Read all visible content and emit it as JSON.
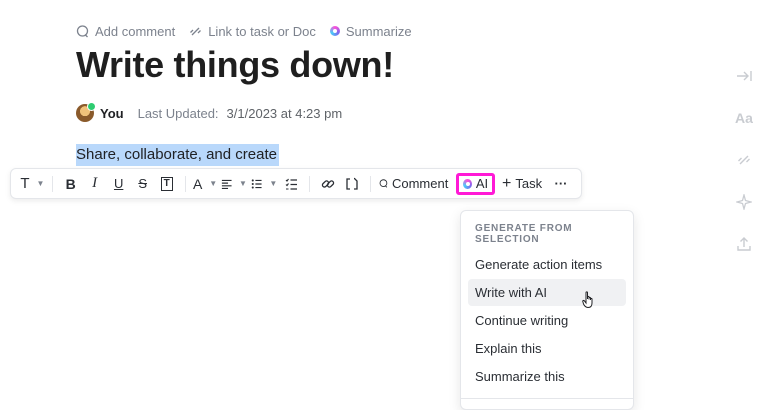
{
  "top_actions": {
    "add_comment": "Add comment",
    "link_task": "Link to task or Doc",
    "summarize": "Summarize"
  },
  "document": {
    "title": "Write things down!",
    "author": "You",
    "last_updated_label": "Last Updated:",
    "last_updated_value": "3/1/2023 at 4:23 pm",
    "selected_text": "Share, collaborate, and create"
  },
  "toolbar": {
    "text_style": "T",
    "bold": "B",
    "italic": "I",
    "underline": "U",
    "strike": "S",
    "text_color": "A",
    "comment_label": "Comment",
    "ai_label": "AI",
    "task_label": "Task",
    "more": "···"
  },
  "ai_menu": {
    "heading": "GENERATE FROM SELECTION",
    "items": [
      {
        "label": "Generate action items"
      },
      {
        "label": "Write with AI"
      },
      {
        "label": "Continue writing"
      },
      {
        "label": "Explain this"
      },
      {
        "label": "Summarize this"
      }
    ],
    "hovered_index": 1
  },
  "right_rail": {
    "font_size_label": "Aa"
  },
  "colors": {
    "highlight": "#b9d8fb",
    "ai_focus_border": "#ff19d6",
    "muted_text": "#7c828d"
  }
}
